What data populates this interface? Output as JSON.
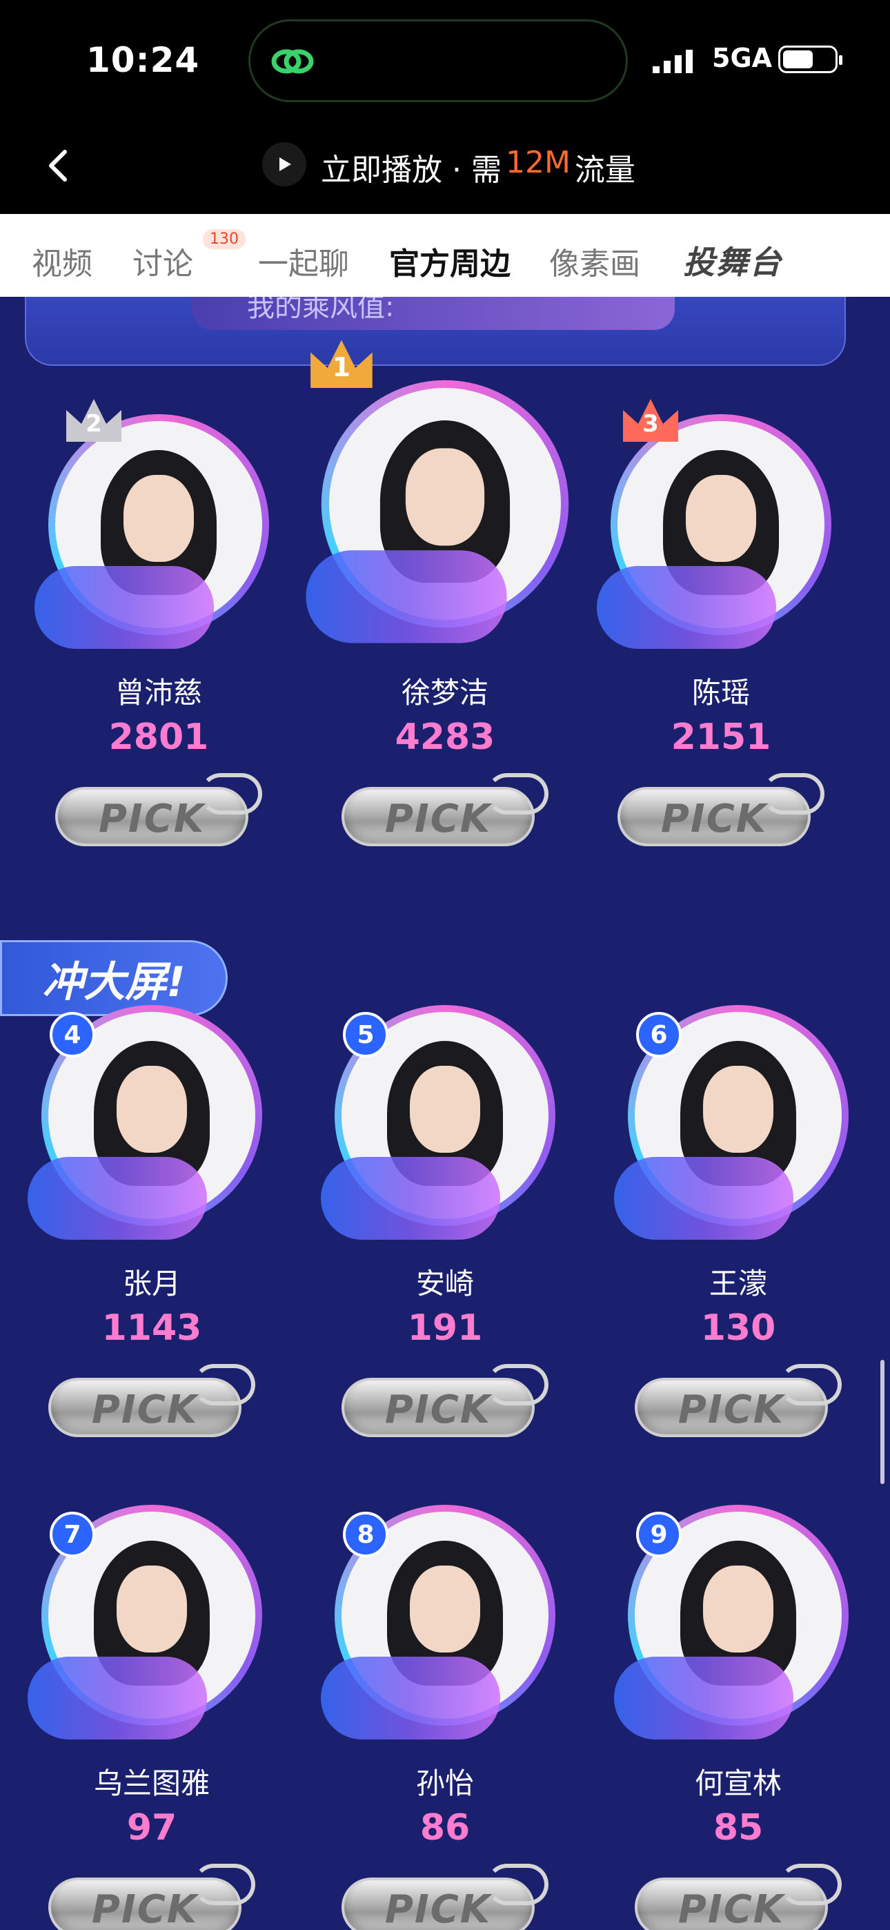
{
  "status_bar": {
    "time": "10:24",
    "network": "5GA"
  },
  "header": {
    "play_text_prefix": "立即播放 · 需",
    "play_size": "12M",
    "play_text_suffix": "流量",
    "accent_color": "#ff6a2e"
  },
  "tabs": [
    {
      "label": "视频"
    },
    {
      "label": "讨论",
      "badge": "130"
    },
    {
      "label": "一起聊"
    },
    {
      "label": "官方周边",
      "active": true
    },
    {
      "label": "像素画"
    },
    {
      "label": "投舞台"
    }
  ],
  "top_card": {
    "text": "我的乘风值:"
  },
  "dash_label": "冲大屏!",
  "pick_label": "PICK",
  "contestants": [
    {
      "rank": "2",
      "name": "曾沛慈",
      "score": "2801"
    },
    {
      "rank": "1",
      "name": "徐梦洁",
      "score": "4283"
    },
    {
      "rank": "3",
      "name": "陈瑶",
      "score": "2151"
    },
    {
      "rank": "4",
      "name": "张月",
      "score": "1143"
    },
    {
      "rank": "5",
      "name": "安崎",
      "score": "191"
    },
    {
      "rank": "6",
      "name": "王濛",
      "score": "130"
    },
    {
      "rank": "7",
      "name": "乌兰图雅",
      "score": "97"
    },
    {
      "rank": "8",
      "name": "孙怡",
      "score": "86"
    },
    {
      "rank": "9",
      "name": "何宣林",
      "score": "85"
    }
  ]
}
